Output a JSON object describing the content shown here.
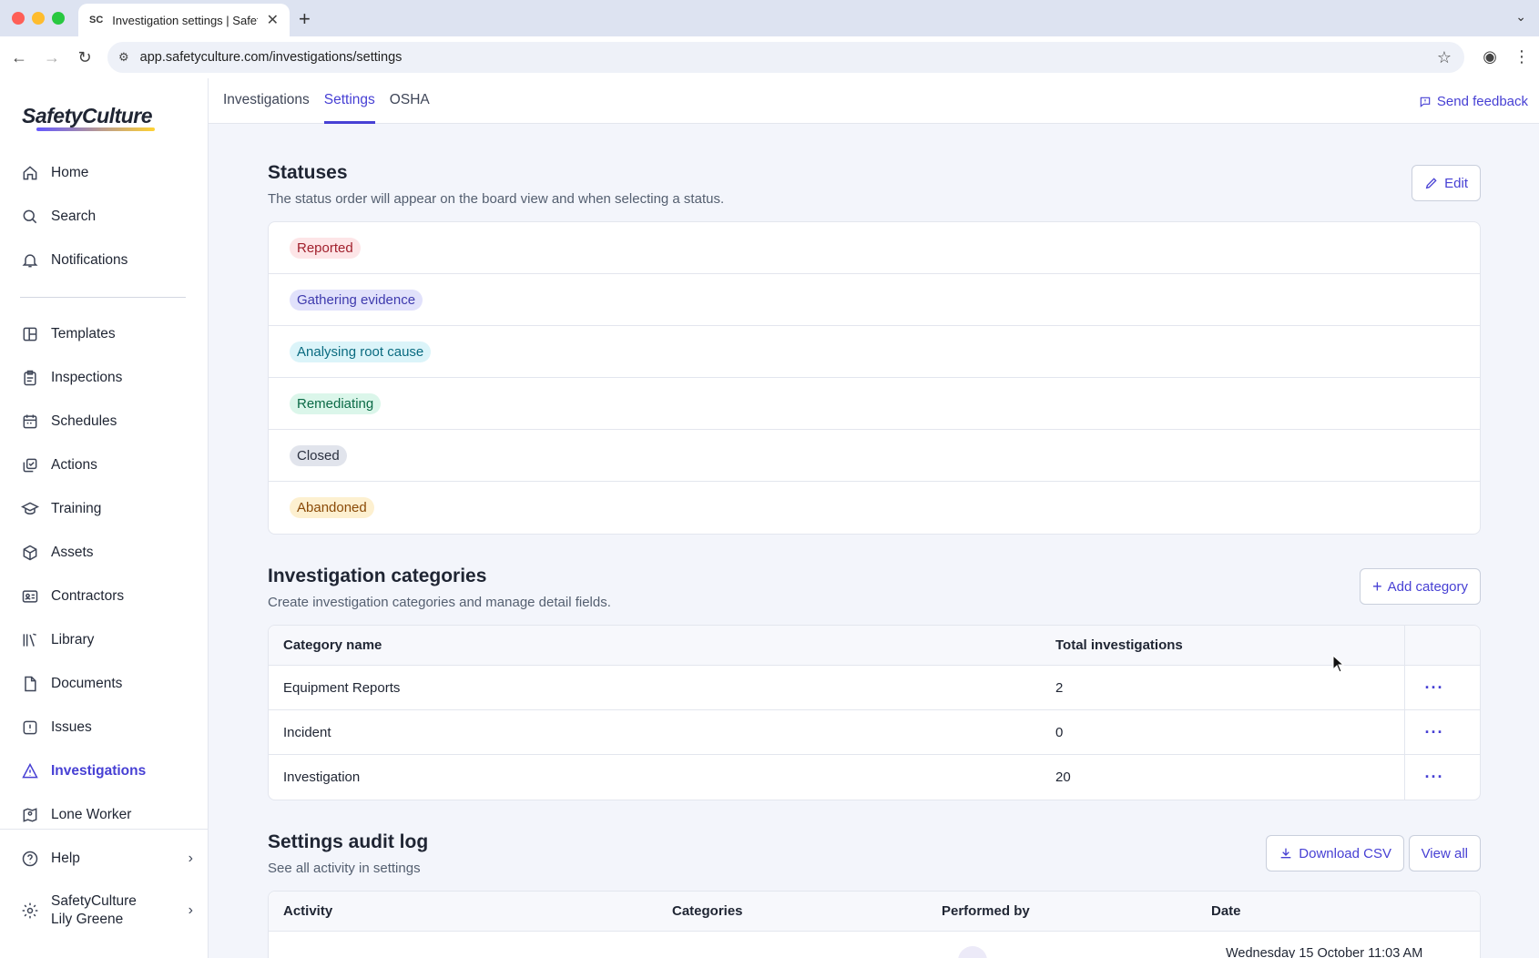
{
  "browser": {
    "tab_title": "Investigation settings | SafetyCulture",
    "favicon_text": "SC",
    "url": "app.safetyculture.com/investigations/settings"
  },
  "brand": {
    "logo_text": "SafetyCulture",
    "accent": "#4740d4"
  },
  "sidebar": {
    "primary": [
      {
        "label": "Home",
        "icon": "home-icon"
      },
      {
        "label": "Search",
        "icon": "search-icon"
      },
      {
        "label": "Notifications",
        "icon": "bell-icon"
      }
    ],
    "secondary": [
      {
        "label": "Templates",
        "icon": "templates-icon"
      },
      {
        "label": "Inspections",
        "icon": "clipboard-icon"
      },
      {
        "label": "Schedules",
        "icon": "calendar-icon"
      },
      {
        "label": "Actions",
        "icon": "actions-icon"
      },
      {
        "label": "Training",
        "icon": "graduation-cap-icon"
      },
      {
        "label": "Assets",
        "icon": "cube-icon"
      },
      {
        "label": "Contractors",
        "icon": "id-card-icon"
      },
      {
        "label": "Library",
        "icon": "library-icon"
      },
      {
        "label": "Documents",
        "icon": "document-icon"
      },
      {
        "label": "Issues",
        "icon": "alert-icon"
      },
      {
        "label": "Investigations",
        "icon": "investigation-icon",
        "active": true
      },
      {
        "label": "Lone Worker",
        "icon": "map-pin-icon"
      }
    ],
    "help_label": "Help",
    "org_name": "SafetyCulture",
    "user_name": "Lily Greene"
  },
  "topnav": {
    "tabs": [
      {
        "label": "Investigations",
        "active": false
      },
      {
        "label": "Settings",
        "active": true
      },
      {
        "label": "OSHA",
        "active": false
      }
    ],
    "feedback_label": "Send feedback"
  },
  "statuses": {
    "title": "Statuses",
    "subtitle": "The status order will appear on the board view and when selecting a status.",
    "edit_label": "Edit",
    "items": [
      {
        "label": "Reported",
        "bg": "#fde5e7",
        "fg": "#a1202d"
      },
      {
        "label": "Gathering evidence",
        "bg": "#e1e1fb",
        "fg": "#3e3aad"
      },
      {
        "label": "Analysing root cause",
        "bg": "#dbf4f9",
        "fg": "#0a6b80"
      },
      {
        "label": "Remediating",
        "bg": "#dbf6ea",
        "fg": "#0b6a46"
      },
      {
        "label": "Closed",
        "bg": "#e1e4ec",
        "fg": "#2b3140"
      },
      {
        "label": "Abandoned",
        "bg": "#fdf0d0",
        "fg": "#8a4a07"
      }
    ]
  },
  "categories": {
    "title": "Investigation categories",
    "subtitle": "Create investigation categories and manage detail fields.",
    "add_label": "Add category",
    "columns": [
      "Category name",
      "Total investigations"
    ],
    "rows": [
      {
        "name": "Equipment Reports",
        "total": "2"
      },
      {
        "name": "Incident",
        "total": "0"
      },
      {
        "name": "Investigation",
        "total": "20"
      }
    ]
  },
  "audit": {
    "title": "Settings audit log",
    "subtitle": "See all activity in settings",
    "download_label": "Download CSV",
    "view_all_label": "View all",
    "columns": [
      "Activity",
      "Categories",
      "Performed by",
      "Date"
    ],
    "first_date": "Wednesday 15 October 11:03 AM"
  }
}
